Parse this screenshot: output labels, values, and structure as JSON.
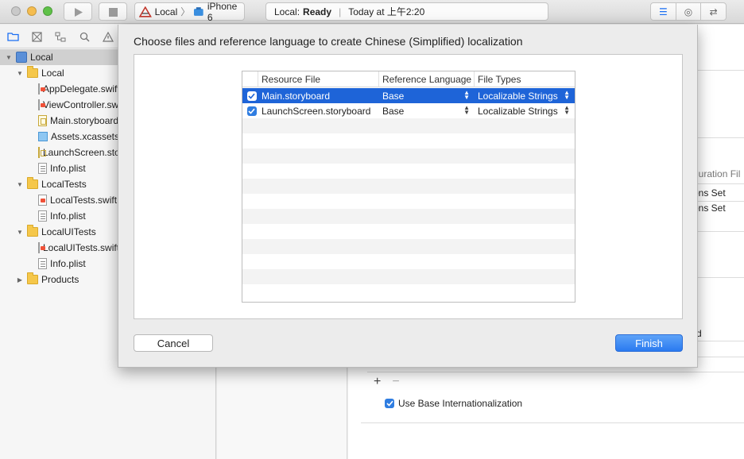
{
  "toolbar": {
    "scheme_project": "Local",
    "scheme_device": "iPhone 6",
    "activity_project": "Local:",
    "activity_status": "Ready",
    "activity_time": "Today at 上午2:20"
  },
  "navigator": {
    "items": [
      {
        "label": "Local",
        "icon": "project-icon",
        "depth": 0,
        "disclosure": "▼",
        "selected": true
      },
      {
        "label": "Local",
        "icon": "folder-icon",
        "depth": 1,
        "disclosure": "▼"
      },
      {
        "label": "AppDelegate.swift",
        "icon": "swift-file-icon",
        "depth": 2
      },
      {
        "label": "ViewController.swift",
        "icon": "swift-file-icon",
        "depth": 2
      },
      {
        "label": "Main.storyboard",
        "icon": "storyboard-file-icon",
        "depth": 2
      },
      {
        "label": "Assets.xcassets",
        "icon": "assets-icon",
        "depth": 2
      },
      {
        "label": "LaunchScreen.storyboard",
        "icon": "storyboard-file-icon",
        "depth": 2
      },
      {
        "label": "Info.plist",
        "icon": "plist-file-icon",
        "depth": 2
      },
      {
        "label": "LocalTests",
        "icon": "folder-icon",
        "depth": 1,
        "disclosure": "▼"
      },
      {
        "label": "LocalTests.swift",
        "icon": "swift-file-icon",
        "depth": 2
      },
      {
        "label": "Info.plist",
        "icon": "plist-file-icon",
        "depth": 2
      },
      {
        "label": "LocalUITests",
        "icon": "folder-icon",
        "depth": 1,
        "disclosure": "▼"
      },
      {
        "label": "LocalUITests.swift",
        "icon": "swift-file-icon",
        "depth": 2
      },
      {
        "label": "Info.plist",
        "icon": "plist-file-icon",
        "depth": 2
      },
      {
        "label": "Products",
        "icon": "folder-icon",
        "depth": 1,
        "disclosure": "▶"
      }
    ]
  },
  "background": {
    "config_header": "guration Fil",
    "config_row_1": "ons Set",
    "config_row_2": "ons Set",
    "localization_cell": "d",
    "use_base_intl": "Use Base Internationalization"
  },
  "sheet": {
    "title": "Choose files and reference language to create Chinese (Simplified) localization",
    "columns": {
      "resource": "Resource File",
      "reference": "Reference Language",
      "types": "File Types"
    },
    "rows": [
      {
        "resource": "Main.storyboard",
        "reference": "Base",
        "types": "Localizable Strings",
        "checked": true,
        "selected": true
      },
      {
        "resource": "LaunchScreen.storyboard",
        "reference": "Base",
        "types": "Localizable Strings",
        "checked": true,
        "selected": false
      }
    ],
    "cancel_label": "Cancel",
    "finish_label": "Finish"
  },
  "colors": {
    "accent": "#1e64d8",
    "selection_gray": "#d0d0d0"
  }
}
